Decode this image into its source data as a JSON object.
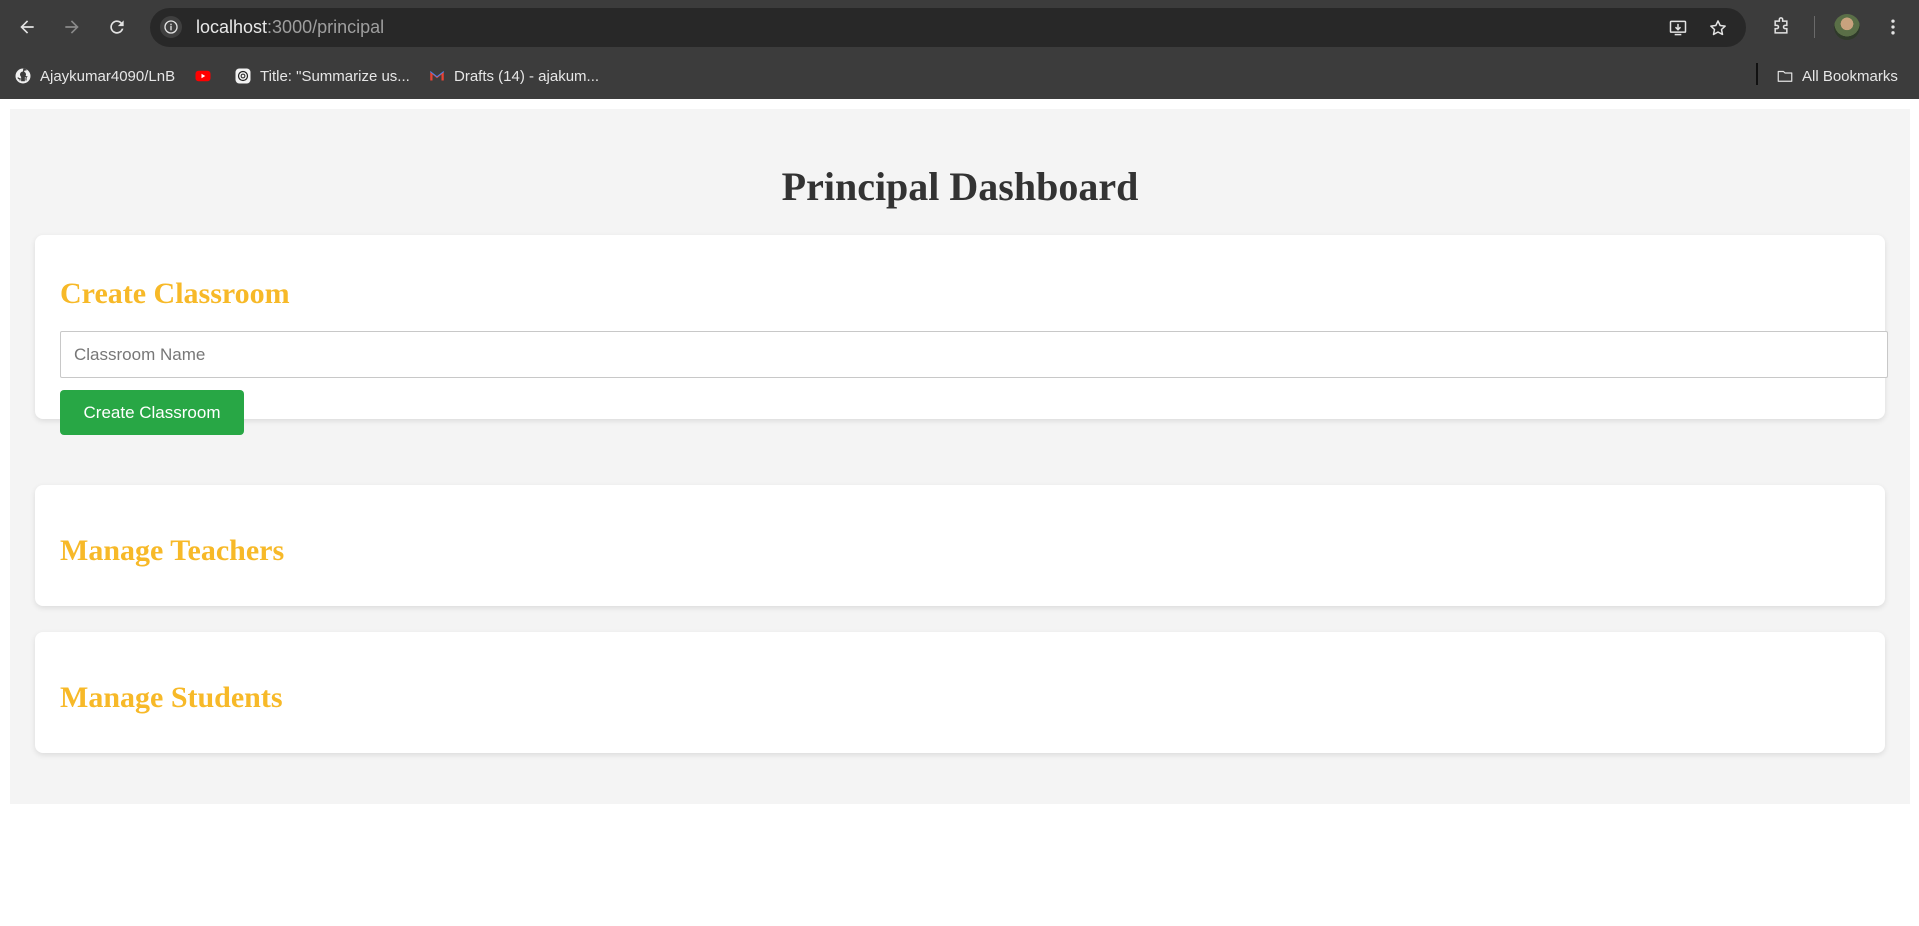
{
  "browser": {
    "url_host": "localhost",
    "url_path": ":3000/principal",
    "bookmarks": [
      {
        "label": "Ajaykumar4090/LnB",
        "icon": "github-icon"
      },
      {
        "label": "",
        "icon": "youtube-icon"
      },
      {
        "label": "Title: \"Summarize us...",
        "icon": "chatgpt-icon"
      },
      {
        "label": "Drafts (14) - ajakum...",
        "icon": "gmail-icon"
      }
    ],
    "all_bookmarks_label": "All Bookmarks"
  },
  "page": {
    "title": "Principal Dashboard",
    "create_classroom": {
      "heading": "Create Classroom",
      "input_placeholder": "Classroom Name",
      "input_value": "",
      "button_label": "Create Classroom"
    },
    "manage_teachers": {
      "heading": "Manage Teachers"
    },
    "manage_students": {
      "heading": "Manage Students"
    }
  },
  "colors": {
    "heading_accent": "#f7b928",
    "button_green": "#28a745",
    "page_bg": "#f4f4f4",
    "chrome_bg": "#3c3c3c"
  }
}
